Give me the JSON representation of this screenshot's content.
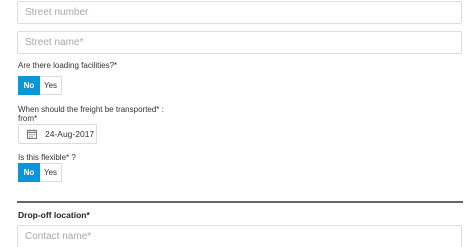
{
  "form": {
    "street_number": {
      "placeholder": "Street number",
      "value": ""
    },
    "street_name": {
      "placeholder": "Street name*",
      "value": ""
    },
    "loading_question": "Are there loading facilities?*",
    "loading_options": {
      "no": "No",
      "yes": "Yes",
      "selected": "No"
    },
    "transport_question": "When should the freight be transported*",
    "transport_colon": ":",
    "from_label": "from*",
    "from_date": "24-Aug-2017",
    "flexible_question": "Is this flexible*",
    "flexible_q": "?",
    "flexible_options": {
      "no": "No",
      "yes": "Yes",
      "selected": "No"
    },
    "dropoff_title": "Drop-off location*",
    "contact_name": {
      "placeholder": "Contact name*",
      "value": ""
    }
  },
  "colors": {
    "accent": "#0a95d8",
    "border": "#dcdcdc",
    "placeholder": "#a8a8a8",
    "divider": "#666666"
  },
  "icons": {
    "date_picker": "calendar-icon"
  }
}
